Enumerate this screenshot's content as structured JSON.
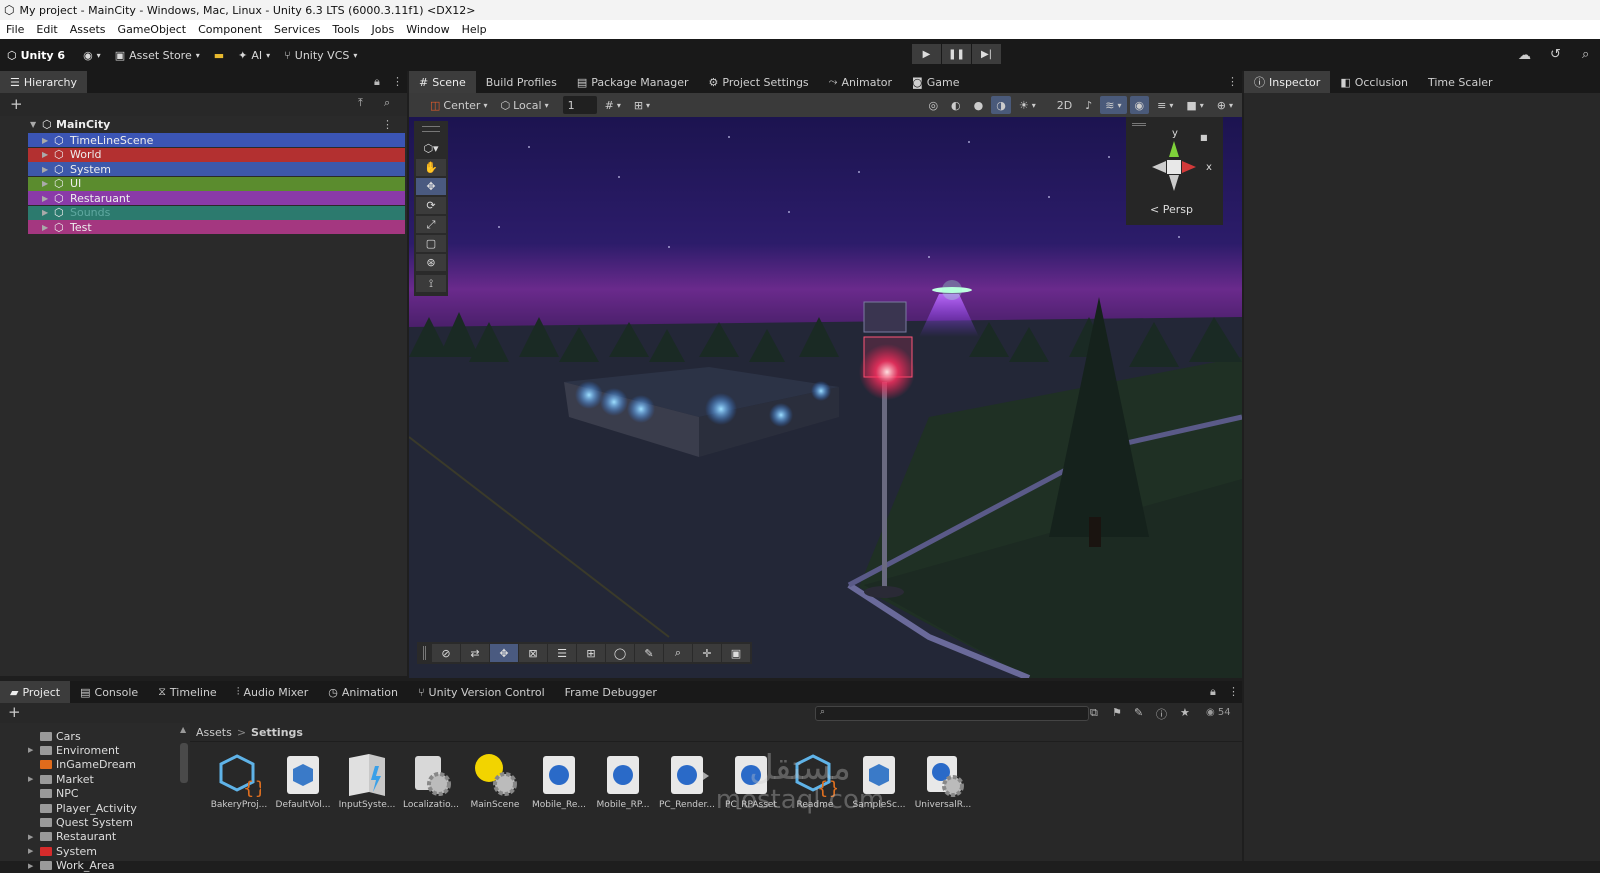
{
  "window": {
    "title": "My project - MainCity - Windows, Mac, Linux - Unity 6.3 LTS (6000.3.11f1) <DX12>"
  },
  "menu": [
    "File",
    "Edit",
    "Assets",
    "GameObject",
    "Component",
    "Services",
    "Tools",
    "Jobs",
    "Window",
    "Help"
  ],
  "toolbar": {
    "account": "Unity 6",
    "asset_store": "Asset Store",
    "ai": "AI",
    "vcs": "Unity VCS"
  },
  "hierarchy": {
    "tab": "Hierarchy",
    "scene": "MainCity",
    "items": [
      {
        "label": "TimeLineScene",
        "color": "#3b55b5"
      },
      {
        "label": "World",
        "color": "#b33030"
      },
      {
        "label": "System",
        "color": "#3d58ab"
      },
      {
        "label": "UI",
        "color": "#5b8c2e"
      },
      {
        "label": "Restaruant",
        "color": "#8a3aa8"
      },
      {
        "label": "Sounds",
        "color": "#2c7a6e"
      },
      {
        "label": "Test",
        "color": "#a43780"
      }
    ]
  },
  "scene_tabs": [
    "Scene",
    "Build Profiles",
    "Package Manager",
    "Project Settings",
    "Animator",
    "Game"
  ],
  "scene_toolbar": {
    "pivot": "Center",
    "space": "Local",
    "grid": "1"
  },
  "gizmo": {
    "y": "y",
    "x": "x",
    "mode": "Persp"
  },
  "right_tabs": [
    "Inspector",
    "Occlusion",
    "Time Scaler"
  ],
  "bottom_tabs": [
    "Project",
    "Console",
    "Timeline",
    "Audio Mixer",
    "Animation",
    "Unity Version Control",
    "Frame Debugger"
  ],
  "project": {
    "breadcrumb": [
      "Assets",
      "Settings"
    ],
    "visible_count": "54",
    "folders": [
      {
        "label": "Cars",
        "color": "#9a9a9a"
      },
      {
        "label": "Enviroment",
        "color": "#9a9a9a"
      },
      {
        "label": "InGameDream",
        "color": "#e06b1c"
      },
      {
        "label": "Market",
        "color": "#9a9a9a"
      },
      {
        "label": "NPC",
        "color": "#9a9a9a"
      },
      {
        "label": "Player_Activity",
        "color": "#9a9a9a"
      },
      {
        "label": "Quest System",
        "color": "#9a9a9a"
      },
      {
        "label": "Restaurant",
        "color": "#9a9a9a"
      },
      {
        "label": "System",
        "color": "#d52b2b"
      },
      {
        "label": "Work_Area",
        "color": "#9a9a9a"
      }
    ],
    "assets": [
      "BakeryProj...",
      "DefaultVol...",
      "InputSyste...",
      "Localizatio...",
      "MainScene",
      "Mobile_Re...",
      "Mobile_RP...",
      "PC_Render...",
      "PC_RPAsset",
      "Readme",
      "SampleSc...",
      "UniversalR..."
    ]
  },
  "watermark": {
    "arabic": "مستقل",
    "latin": "mostaql.com"
  }
}
